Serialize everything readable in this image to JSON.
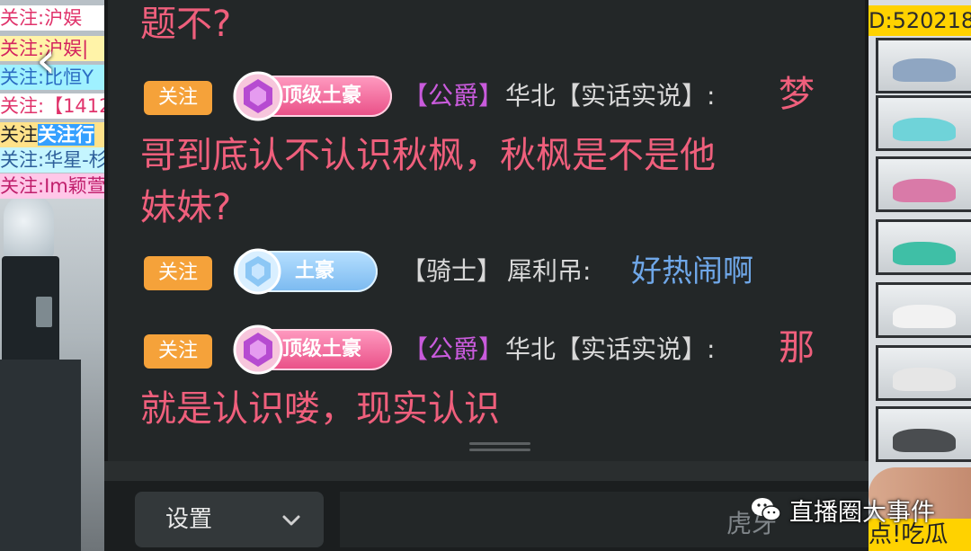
{
  "left_strip": {
    "banners": [
      "关注:沪娱",
      "关注:沪娱|",
      "关注:比恒Y",
      "关注:【1412",
      "关注",
      "关注:华星-杉",
      "关注:Im颖萱"
    ],
    "banner5_highlight": "关注行"
  },
  "right_strip": {
    "id_text": "D:520218",
    "bottom_text": "点!吃瓜"
  },
  "chat": {
    "messages": [
      {
        "continuation": "题不?"
      },
      {
        "follow_label": "关注",
        "rank": "顶级土豪",
        "title": "【公爵】",
        "name": "华北【实话实说】:",
        "text_line1": "梦",
        "text_line2": "哥到底认不认识秋枫，秋枫是不是他",
        "text_line3": "妹妹?"
      },
      {
        "follow_label": "关注",
        "rank": "土豪",
        "title": "【骑士】",
        "name": "犀利吊:",
        "text_line1": "好热闹啊"
      },
      {
        "follow_label": "关注",
        "rank": "顶级土豪",
        "title": "【公爵】",
        "name": "华北【实话实说】:",
        "text_line1": "那",
        "text_line2": "就是认识喽，现实认识"
      }
    ],
    "colors": {
      "message_pink": "#ef5f7c",
      "message_blue": "#6fa7e8",
      "follow_orange": "#f5a23a",
      "title_purple": "#c95bdc"
    }
  },
  "bottom_bar": {
    "settings_label": "设置",
    "input_placeholder": "虎牙"
  },
  "watermark": {
    "text": "直播圈大事件",
    "icon": "wechat-icon"
  }
}
